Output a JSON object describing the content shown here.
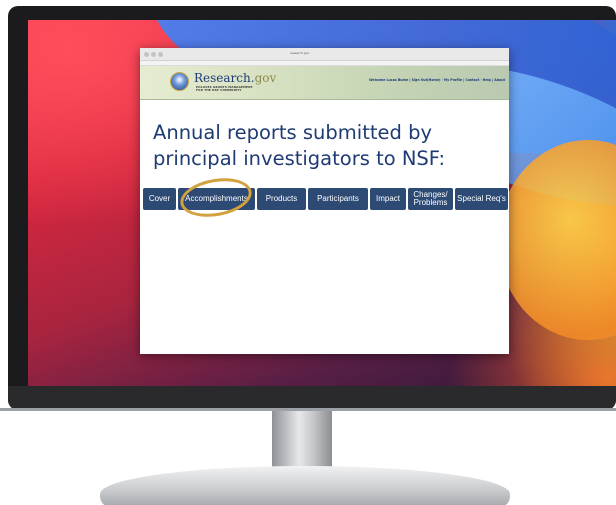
{
  "browser": {
    "url": "research.gov"
  },
  "banner": {
    "logo_main": "Research.",
    "logo_suffix": "gov",
    "logo_sub_line1": "POLICIES GRANTS MANAGEMENT",
    "logo_sub_line2": "FOR THE NSF COMMUNITY",
    "links": "Welcome Lucas Burke | Sign Out(Home) · My Profile | Contact · Help | About"
  },
  "page": {
    "heading": "Annual reports submitted by principal investigators to NSF:"
  },
  "tabs": [
    {
      "label": "Cover"
    },
    {
      "label": "Accomplishments"
    },
    {
      "label": "Products"
    },
    {
      "label": "Participants"
    },
    {
      "label": "Impact"
    },
    {
      "line1": "Changes/",
      "line2": "Problems"
    },
    {
      "label": "Special Req's"
    }
  ],
  "colors": {
    "tab_bg": "#2c4a74",
    "highlight": "#d2a23f",
    "heading": "#1f3b73"
  }
}
